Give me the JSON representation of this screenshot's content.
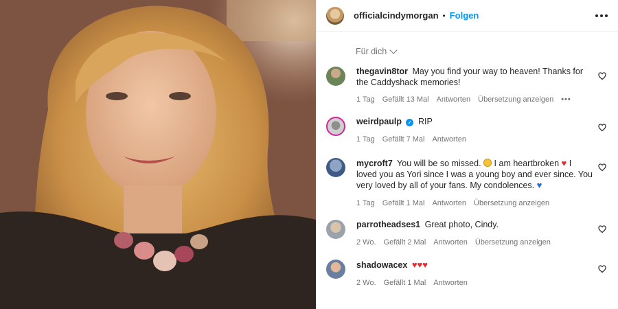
{
  "header": {
    "username": "officialcindymorgan",
    "separator": "•",
    "follow_label": "Folgen"
  },
  "filter": {
    "label": "Für dich"
  },
  "comments": [
    {
      "username": "thegavin8tor",
      "text": "May you find your way to heaven! Thanks for the Caddyshack memories!",
      "time": "1 Tag",
      "likes": "Gefällt 13 Mal",
      "reply": "Antworten",
      "translate": "Übersetzung anzeigen",
      "more": "•••"
    },
    {
      "username": "weirdpaulp",
      "text": "RIP",
      "time": "1 Tag",
      "likes": "Gefällt 7 Mal",
      "reply": "Antworten"
    },
    {
      "username": "mycroft7",
      "text_part1": "You will be so missed.",
      "text_part2": "I am heartbroken",
      "text_part3": "I loved you as Yori since I was a young boy and ever since. You very loved by all of your fans. My condolences.",
      "emoji_heart": "♥",
      "emoji_blue_heart": "♥",
      "time": "1 Tag",
      "likes": "Gefällt 1 Mal",
      "reply": "Antworten",
      "translate": "Übersetzung anzeigen"
    },
    {
      "username": "parrotheadses1",
      "text": "Great photo, Cindy.",
      "time": "2 Wo.",
      "likes": "Gefällt 2 Mal",
      "reply": "Antworten",
      "translate": "Übersetzung anzeigen"
    },
    {
      "username": "shadowacex",
      "text": "♥♥♥",
      "time": "2 Wo.",
      "likes": "Gefällt 1 Mal",
      "reply": "Antworten"
    }
  ],
  "icons": {
    "verified": "✓",
    "heart": "heart-outline-icon",
    "more": "more-horizontal-icon"
  },
  "colors": {
    "follow_blue": "#0095f6",
    "muted_text": "#737373",
    "red_heart": "#ed2a2a"
  }
}
